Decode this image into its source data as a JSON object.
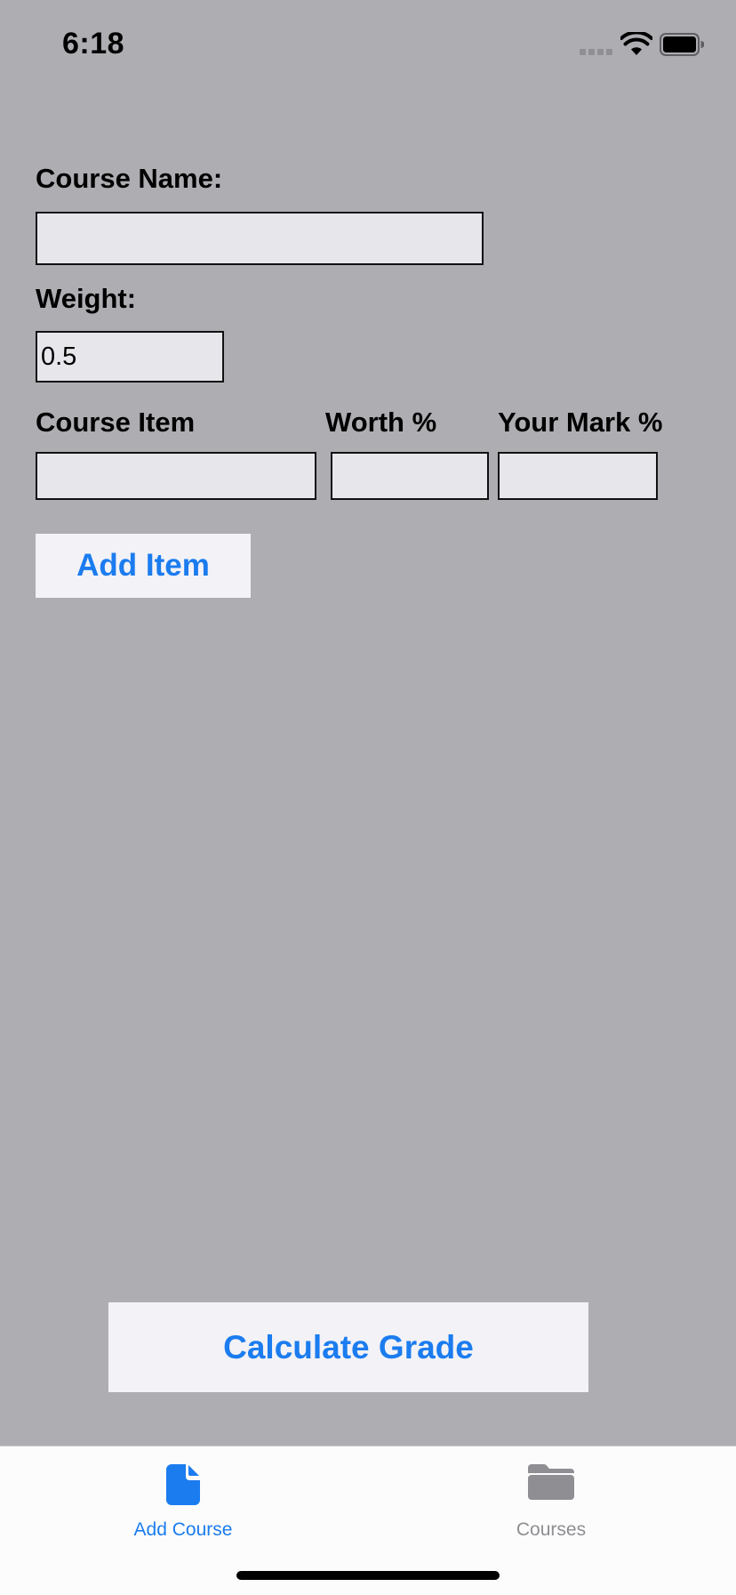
{
  "status_bar": {
    "time": "6:18"
  },
  "form": {
    "course_name_label": "Course Name:",
    "course_name_value": "",
    "weight_label": "Weight:",
    "weight_value": "0.5",
    "course_item_label": "Course Item",
    "worth_label": "Worth %",
    "mark_label": "Your Mark %",
    "course_item_value": "",
    "worth_value": "",
    "mark_value": ""
  },
  "buttons": {
    "add_item": "Add Item",
    "calculate_grade": "Calculate Grade"
  },
  "tab_bar": {
    "tabs": [
      {
        "label": "Add Course",
        "icon": "document-icon",
        "selected": true
      },
      {
        "label": "Courses",
        "icon": "folder-icon",
        "selected": false
      }
    ]
  },
  "colors": {
    "accent": "#1b7cef",
    "background": "#aeadb2",
    "field_background": "#e7e6eb",
    "button_background": "#f2f2f7",
    "inactive_tab": "#8e8e93"
  }
}
